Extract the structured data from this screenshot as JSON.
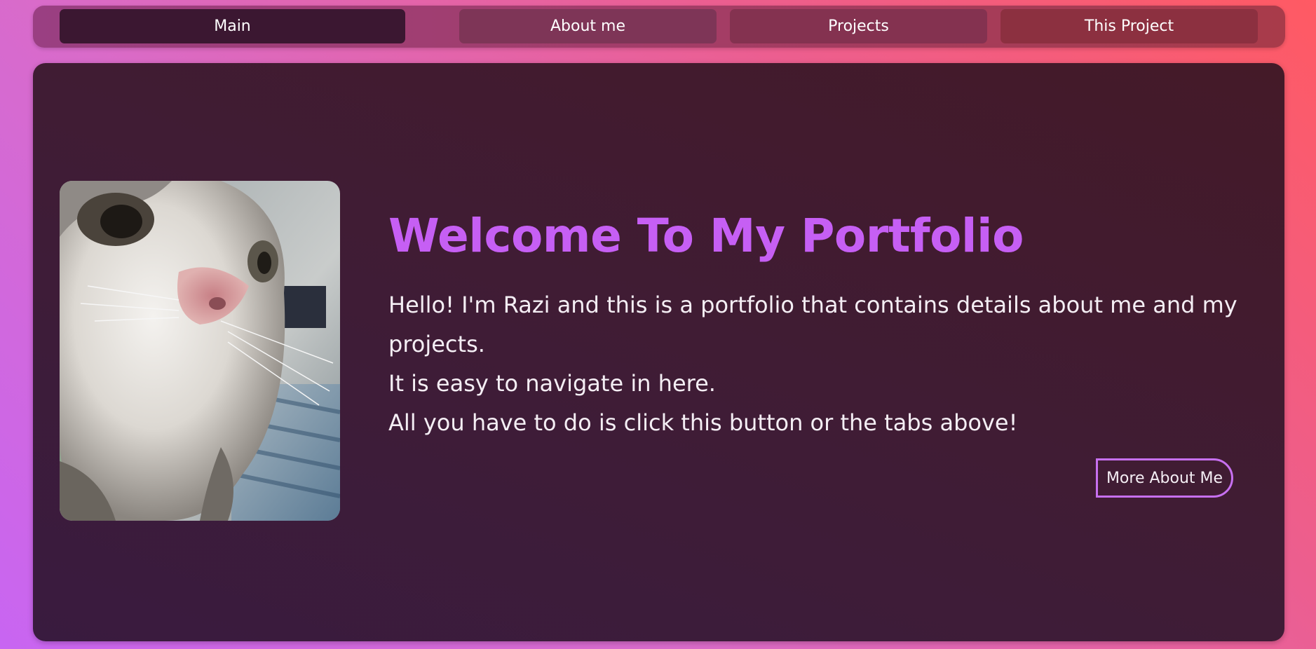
{
  "nav": {
    "tabs": [
      {
        "label": "Main",
        "active": true
      },
      {
        "label": "About me",
        "active": false
      },
      {
        "label": "Projects",
        "active": false
      },
      {
        "label": "This Project",
        "active": false
      }
    ]
  },
  "hero": {
    "image_subject": "cat-photo",
    "title": "Welcome To My Portfolio",
    "paragraph_lines": [
      "Hello! I'm Razi and this is a portfolio that contains details about me and my projects.",
      "It is easy to navigate in here.",
      "All you have to do is click this button or the tabs above!"
    ],
    "cta_label": "More About Me"
  },
  "colors": {
    "accent": "#c65ff4",
    "active_tab": "#3b1731",
    "card_bg": "#3f1c36"
  }
}
